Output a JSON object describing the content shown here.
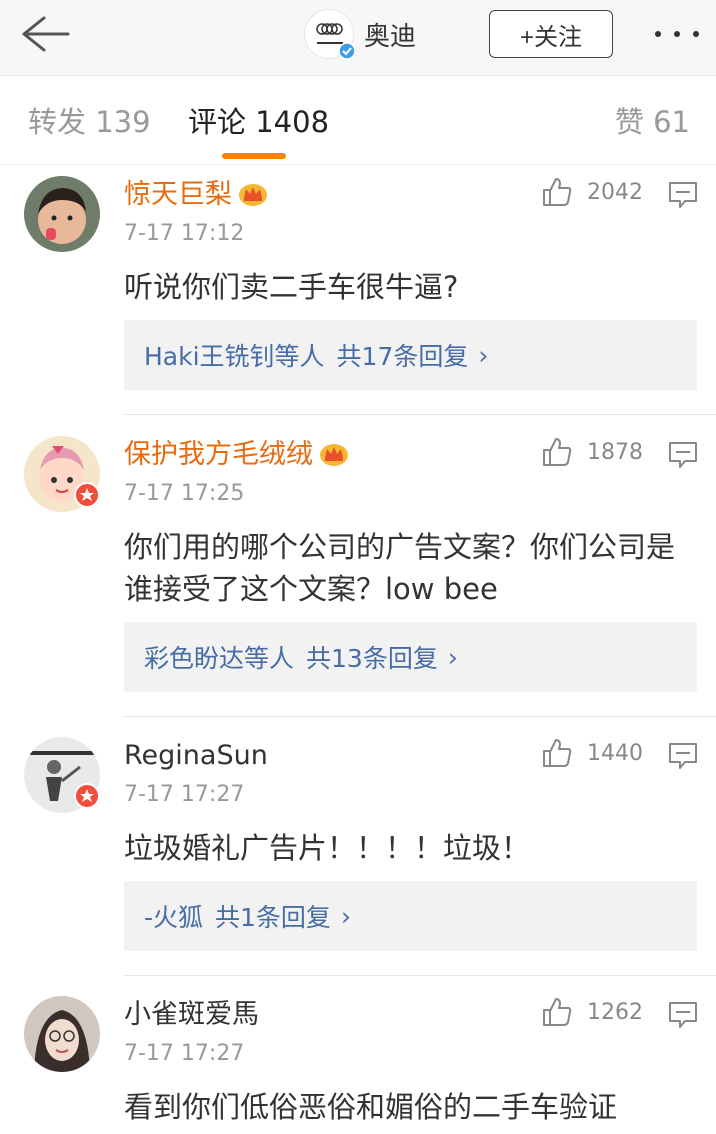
{
  "header": {
    "account_name": "奥迪",
    "follow_label": "+关注",
    "brand_color": "#ff8200"
  },
  "tabs": [
    {
      "label": "转发 139",
      "active": false
    },
    {
      "label": "评论 1408",
      "active": true
    },
    {
      "label": "赞 61",
      "active": false
    }
  ],
  "comments": [
    {
      "user": "惊天巨梨",
      "vip_crown": true,
      "time": "7-17 17:12",
      "likes": "2042",
      "text": "听说你们卖二手车很牛逼?",
      "replies": {
        "who": "Haki王铣钊等人",
        "count": "共17条回复",
        "chevron": "›"
      }
    },
    {
      "user": "保护我方毛绒绒",
      "vip_crown": true,
      "verified": true,
      "time": "7-17 17:25",
      "likes": "1878",
      "text": "你们用的哪个公司的广告文案？你们公司是谁接受了这个文案？low bee",
      "replies": {
        "who": "彩色盼达等人",
        "count": "共13条回复",
        "chevron": "›"
      }
    },
    {
      "user": "ReginaSun",
      "vip_crown": false,
      "verified": true,
      "time": "7-17 17:27",
      "likes": "1440",
      "text": "垃圾婚礼广告片！！！！垃圾！",
      "replies": {
        "who": "-火狐",
        "count": "共1条回复",
        "chevron": "›"
      }
    },
    {
      "user": "小雀斑爱馬",
      "vip_crown": false,
      "time": "7-17 17:27",
      "likes": "1262",
      "text": "看到你们低俗恶俗和媚俗的二手车验证"
    }
  ],
  "icons": {
    "back": "back-arrow-icon",
    "more": "more-dots-icon",
    "like": "thumbs-up-icon",
    "reply": "comment-bubble-icon",
    "crown": "vip-crown-icon",
    "verified": "verified-badge-icon"
  }
}
